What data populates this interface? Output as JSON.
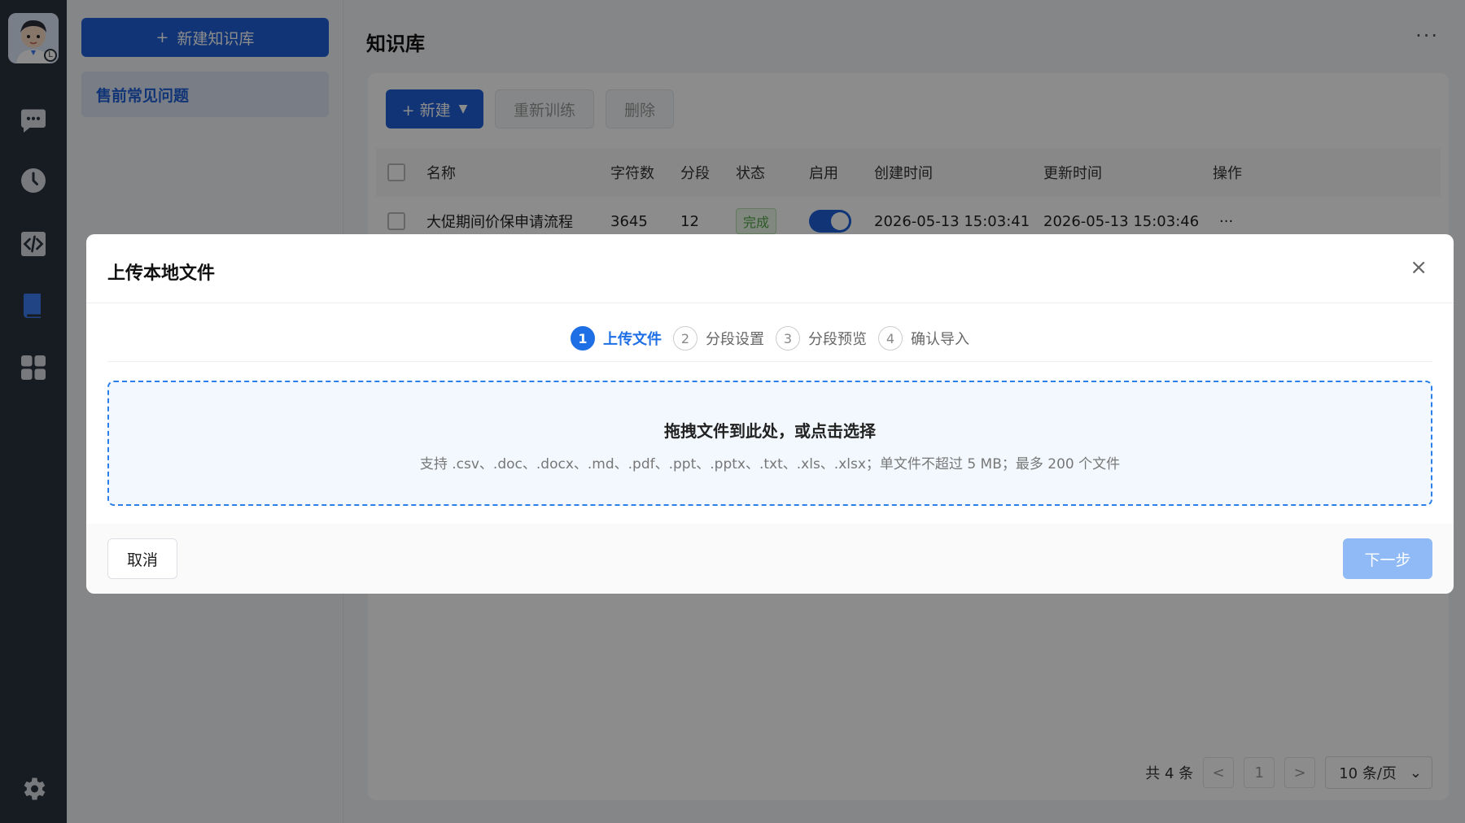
{
  "rail": {
    "avatar_badge": "L",
    "items": [
      {
        "name": "chat-bubble-icon",
        "color": "#d9dde3"
      },
      {
        "name": "clock-icon",
        "color": "#d9dde3"
      },
      {
        "name": "code-icon",
        "color": "#d9dde3"
      },
      {
        "name": "book-icon",
        "color": "#3d7ff0"
      },
      {
        "name": "grid-icon",
        "color": "#d9dde3"
      },
      {
        "name": "gear-icon",
        "color": "#d9dde3"
      }
    ]
  },
  "kb_sidebar": {
    "new_kb_label": "新建知识库",
    "plus_glyph": "+",
    "items": [
      {
        "label": "售前常见问题"
      }
    ]
  },
  "main": {
    "title": "知识库",
    "more_glyph": "···",
    "toolbar": {
      "new_label": "+ 新建",
      "dropdown_glyph": "▼",
      "retrain_label": "重新训练",
      "delete_label": "删除"
    },
    "table": {
      "columns": [
        "名称",
        "字符数",
        "分段",
        "状态",
        "启用",
        "创建时间",
        "更新时间",
        "操作"
      ],
      "rows": [
        {
          "name": "大促期间价保申请流程",
          "chars": "3645",
          "segments": "12",
          "status": "完成",
          "enabled": true,
          "created": "2026-05-13 15:03:41",
          "updated": "2026-05-13 15:03:46",
          "action": "···"
        }
      ]
    },
    "pagination": {
      "total": "共 4 条",
      "prev": "<",
      "page": "1",
      "next": ">",
      "page_size": "10 条/页",
      "size_glyph": "⌄"
    }
  },
  "modal": {
    "title": "上传本地文件",
    "close_glyph": "×",
    "steps": [
      {
        "num": "1",
        "label": "上传文件"
      },
      {
        "num": "2",
        "label": "分段设置"
      },
      {
        "num": "3",
        "label": "分段预览"
      },
      {
        "num": "4",
        "label": "确认导入"
      }
    ],
    "active_step": 1,
    "dropzone": {
      "main": "拖拽文件到此处，或点击选择",
      "sub": "支持 .csv、.doc、.docx、.md、.pdf、.ppt、.pptx、.txt、.xls、.xlsx；单文件不超过 5 MB；最多 200 个文件"
    },
    "cancel_label": "取消",
    "next_label": "下一步"
  },
  "colors": {
    "primary": "#1e5fd6",
    "accent": "#1e6fe6",
    "rail_bg": "#2b3440",
    "next_disabled": "#8fbaf5",
    "done_tag": "#52a447"
  }
}
